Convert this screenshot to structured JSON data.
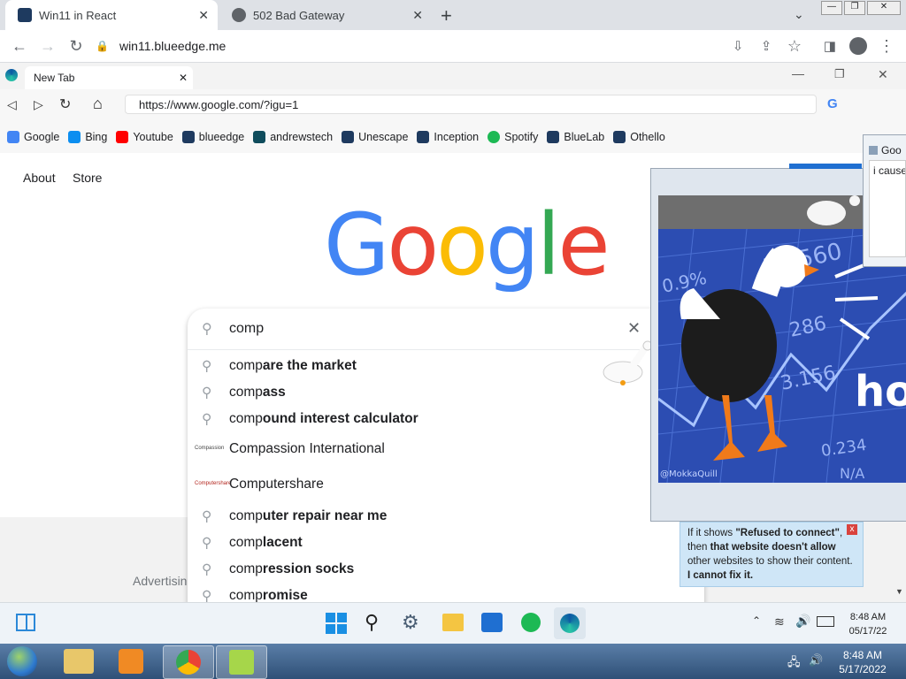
{
  "chrome": {
    "tabs": [
      {
        "title": "Win11 in React",
        "active": true
      },
      {
        "title": "502 Bad Gateway",
        "active": false
      }
    ],
    "new_tab": "+",
    "url": "win11.blueedge.me"
  },
  "edge": {
    "tab_title": "New Tab",
    "url": "https://www.google.com/?igu=1"
  },
  "bookmarks": [
    {
      "label": "Google",
      "color": "#4285f4"
    },
    {
      "label": "Bing",
      "color": "#0c8ef0"
    },
    {
      "label": "Youtube",
      "color": "#ff0000"
    },
    {
      "label": "blueedge",
      "color": "#1e3a5f"
    },
    {
      "label": "andrewstech",
      "color": "#0f4c5c"
    },
    {
      "label": "Unescape",
      "color": "#1e3a5f"
    },
    {
      "label": "Inception",
      "color": "#1e3a5f"
    },
    {
      "label": "Spotify",
      "color": "#1db954"
    },
    {
      "label": "BlueLab",
      "color": "#1e3a5f"
    },
    {
      "label": "Othello",
      "color": "#1e3a5f"
    }
  ],
  "google": {
    "about": "About",
    "store": "Store",
    "logo_letters": [
      "G",
      "o",
      "o",
      "g",
      "l",
      "e"
    ],
    "search_value": "comp",
    "footer_text": "Advertisin",
    "suggestions": [
      {
        "prefix": "comp",
        "rest": "are the market"
      },
      {
        "prefix": "comp",
        "rest": "ass"
      },
      {
        "prefix": "comp",
        "rest": "ound interest calculator"
      },
      {
        "entity": "Compassion International",
        "thumb": "Compassion"
      },
      {
        "entity": "Computershare",
        "thumb": "Computershare"
      },
      {
        "prefix": "comp",
        "rest": "uter repair near me"
      },
      {
        "prefix": "comp",
        "rest": "lacent"
      },
      {
        "prefix": "comp",
        "rest": "ression socks"
      },
      {
        "prefix": "comp",
        "rest": "romise"
      }
    ]
  },
  "gif": {
    "watermark": "@MokkaQuill",
    "text": "ho",
    "ticker_numbers": [
      "11.560",
      "0.9%",
      "286",
      "3.156",
      "0.234",
      "N/A"
    ]
  },
  "notification": {
    "title": "Goo",
    "body": "i cause"
  },
  "tooltip": {
    "text_before": "If it shows ",
    "bold1": "\"Refused to connect\"",
    "text_mid": ", then ",
    "bold2": "that website doesn't allow",
    "text_mid2": " other websites to show their content. ",
    "bold3": "I cannot fix it.",
    "close": "x"
  },
  "win11_taskbar": {
    "time": "8:48 AM",
    "date": "05/17/22"
  },
  "win7_taskbar": {
    "time": "8:48 AM",
    "date": "5/17/2022"
  }
}
